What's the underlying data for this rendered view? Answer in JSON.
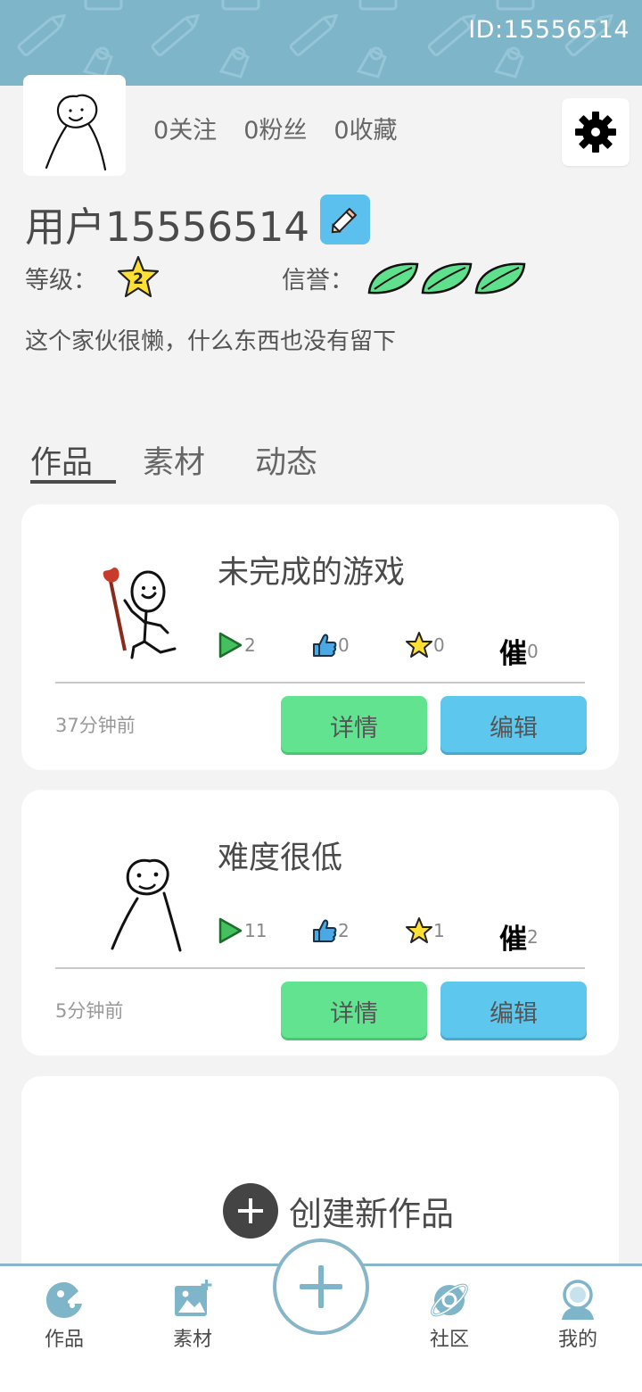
{
  "header": {
    "user_id": "ID:15556514"
  },
  "profile": {
    "stats": [
      {
        "count": "0",
        "label": "关注"
      },
      {
        "count": "0",
        "label": "粉丝"
      },
      {
        "count": "0",
        "label": "收藏"
      }
    ],
    "username": "用户15556514",
    "level_label": "等级：",
    "level_value": "2",
    "reputation_label": "信誉：",
    "reputation_leaves": 3,
    "bio": "这个家伙很懒，什么东西也没有留下"
  },
  "tabs": [
    {
      "label": "作品",
      "active": true
    },
    {
      "label": "素材",
      "active": false
    },
    {
      "label": "动态",
      "active": false
    }
  ],
  "works": [
    {
      "title": "未完成的游戏",
      "plays": "2",
      "likes": "0",
      "stars": "0",
      "urge_label": "催",
      "urges": "0",
      "time": "37分钟前",
      "detail_label": "详情",
      "edit_label": "编辑"
    },
    {
      "title": "难度很低",
      "plays": "11",
      "likes": "2",
      "stars": "1",
      "urge_label": "催",
      "urges": "2",
      "time": "5分钟前",
      "detail_label": "详情",
      "edit_label": "编辑"
    }
  ],
  "create": {
    "label": "创建新作品"
  },
  "nav": {
    "items": [
      {
        "label": "作品",
        "icon": "works-icon"
      },
      {
        "label": "素材",
        "icon": "material-icon"
      },
      {
        "label": "社区",
        "icon": "community-icon"
      },
      {
        "label": "我的",
        "icon": "profile-icon"
      }
    ],
    "center_icon": "plus-icon"
  },
  "colors": {
    "header_bg": "#7eb5c9",
    "detail_button": "#62e38f",
    "edit_button": "#5ec7ee",
    "nav_accent": "#86b6c8"
  }
}
